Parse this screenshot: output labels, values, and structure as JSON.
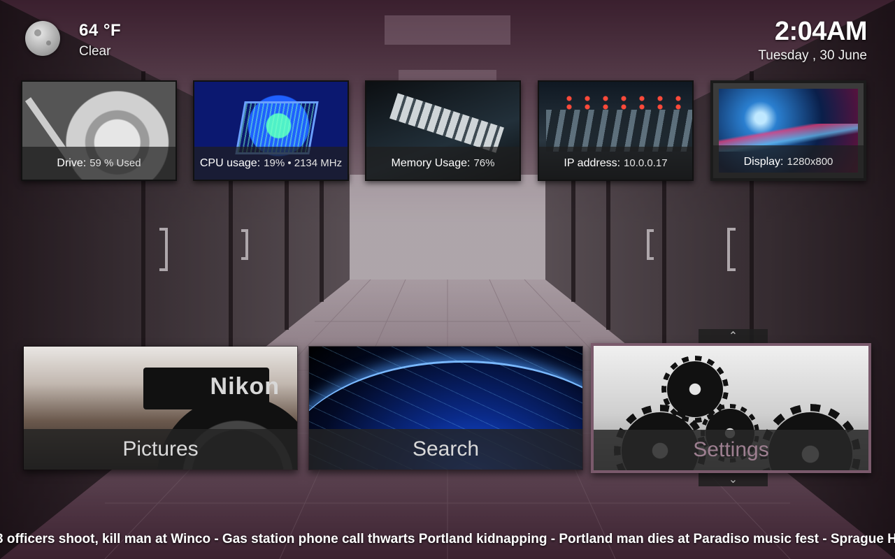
{
  "weather": {
    "icon": "moon-icon",
    "temperature": "64 °F",
    "condition": "Clear"
  },
  "clock": {
    "time": "2:04AM",
    "date": "Tuesday , 30 June"
  },
  "info_tiles": [
    {
      "key": "Drive:",
      "value": "59 % Used"
    },
    {
      "key": "CPU usage:",
      "value": "19% • 2134 MHz"
    },
    {
      "key": "Memory Usage:",
      "value": "76%"
    },
    {
      "key": "IP address:",
      "value": "10.0.0.17"
    },
    {
      "key": "Display:",
      "value": "1280x800"
    }
  ],
  "menu": {
    "items": [
      {
        "label": "Pictures",
        "brand_text": "Nikon"
      },
      {
        "label": "Search"
      },
      {
        "label": "Settings"
      }
    ],
    "selected": "Settings"
  },
  "ticker": {
    "text": "3 officers shoot, kill man at Winco - Gas station phone call thwarts Portland kidnapping - Portland man dies at Paradiso music fest - Sprague H"
  },
  "colors": {
    "background_tint": "#5a2846",
    "selected_border": "#7a5a6c",
    "selected_label": "#9d7f90"
  }
}
